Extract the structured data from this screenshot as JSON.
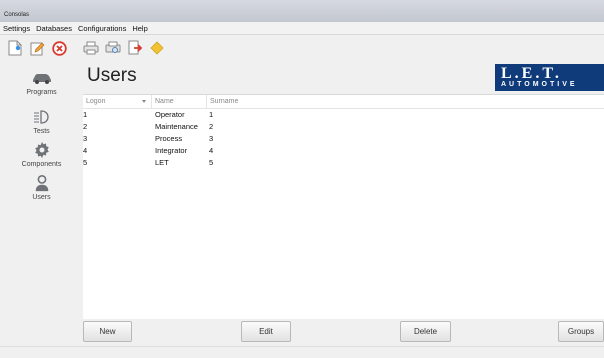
{
  "window": {
    "title": "Consolas"
  },
  "menu": [
    "Settings",
    "Databases",
    "Configurations",
    "Help"
  ],
  "toolbar": {
    "icons": [
      "new-document-icon",
      "edit-icon",
      "delete-icon",
      "print-icon",
      "print-preview-icon",
      "export-icon",
      "favorite-icon"
    ]
  },
  "sidebar": {
    "items": [
      {
        "label": "Programs",
        "icon": "car-icon"
      },
      {
        "label": "Tests",
        "icon": "headlight-icon"
      },
      {
        "label": "Components",
        "icon": "gear-icon"
      },
      {
        "label": "Users",
        "icon": "user-icon"
      }
    ]
  },
  "page": {
    "title": "Users",
    "logo_line1": "L.E.T.",
    "logo_line2": "AUTOMOTIVE"
  },
  "table": {
    "columns": [
      "Logon",
      "Name",
      "Surname"
    ],
    "rows": [
      [
        "1",
        "Operator",
        "1"
      ],
      [
        "2",
        "Maintenance",
        "2"
      ],
      [
        "3",
        "Process",
        "3"
      ],
      [
        "4",
        "Integrator",
        "4"
      ],
      [
        "5",
        "LET",
        "5"
      ]
    ]
  },
  "buttons": {
    "new": "New",
    "edit": "Edit",
    "delete": "Delete",
    "groups": "Groups"
  },
  "colors": {
    "logo_bg": "#0f3b7a",
    "delete_red": "#d93a2f",
    "favorite_yellow": "#f2c230"
  }
}
